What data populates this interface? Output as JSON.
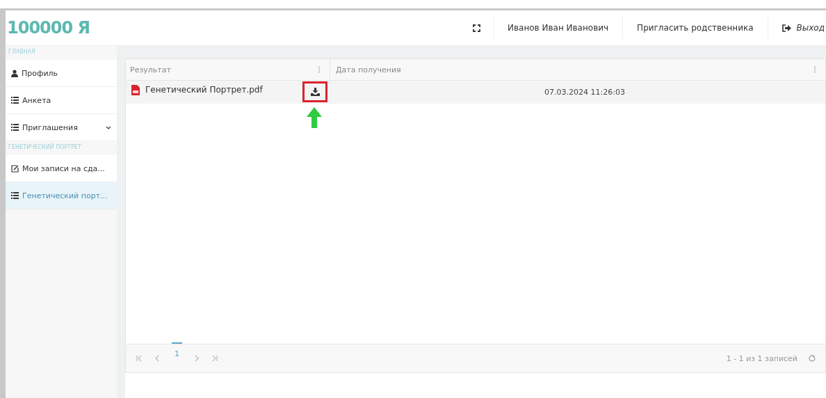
{
  "logo": {
    "text": "100000 Я"
  },
  "header": {
    "user": "Иванов Иван Иванович",
    "invite": "Пригласить родственника",
    "logout": "Выход"
  },
  "sidebar": {
    "sections": [
      {
        "title": "ГЛАВНАЯ",
        "items": [
          {
            "label": "Профиль",
            "kind": "user",
            "selected": false,
            "submenu": false
          },
          {
            "label": "Анкета",
            "kind": "list",
            "selected": false,
            "submenu": false
          },
          {
            "label": "Приглашения",
            "kind": "list",
            "selected": false,
            "submenu": true
          }
        ]
      },
      {
        "title": "ГЕНЕТИЧЕСКИЙ ПОРТРЕТ",
        "items": [
          {
            "label": "Мои записи на сда...",
            "kind": "edit",
            "selected": false,
            "submenu": false
          },
          {
            "label": "Генетический порт...",
            "kind": "list",
            "selected": true,
            "submenu": false
          }
        ]
      }
    ]
  },
  "table": {
    "columns": [
      "Результат",
      "Дата получения"
    ],
    "rows": [
      {
        "file": "Генетический Портрет.pdf",
        "date": "07.03.2024 11:26:03",
        "highlighted": true
      }
    ]
  },
  "pager": {
    "page": "1",
    "summary": "1 - 1 из 1 записей"
  }
}
